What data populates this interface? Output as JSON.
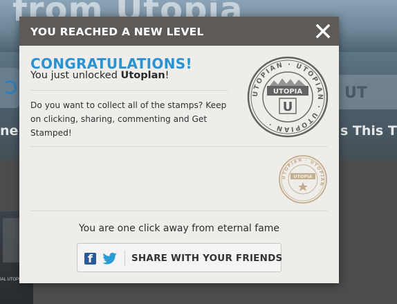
{
  "background": {
    "hero_text": "from Utopia",
    "left_caption": "ne",
    "right_card_text": "UT",
    "right_caption": "s This Thi",
    "thumb_caption": "IAL UTOPIAN"
  },
  "modal": {
    "title": "YOU REACHED A NEW LEVEL",
    "close_icon": "close-icon",
    "congrats": "CONGRATULATIONS!",
    "unlock_prefix": "You just unlocked ",
    "unlock_level": "Utoplan",
    "unlock_suffix": "!",
    "body": "Do you want to collect all of the stamps? Keep on clicking, sharing, commenting and Get Stamped!",
    "stamp_main": {
      "ring_text": "UTOPIAN · UTOPIAN · UTOPIAN ·",
      "banner": "UTOPIA",
      "letter": "U",
      "color": "#4a4a4a"
    },
    "stamp_small": {
      "ring_text": "UTOPIAN · UTOPIAN ·",
      "banner": "UTOPIA",
      "color": "#b89a72"
    },
    "fame": "You are one click away from eternal fame",
    "share": {
      "label": "SHARE WITH YOUR FRIENDS",
      "icons": [
        "facebook-icon",
        "twitter-icon"
      ],
      "facebook_color": "#2a5a9a",
      "twitter_color": "#2a9bd6"
    }
  },
  "colors": {
    "header_bg": "#5d5a57",
    "modal_bg": "#efedea",
    "accent": "#2a93cf"
  }
}
